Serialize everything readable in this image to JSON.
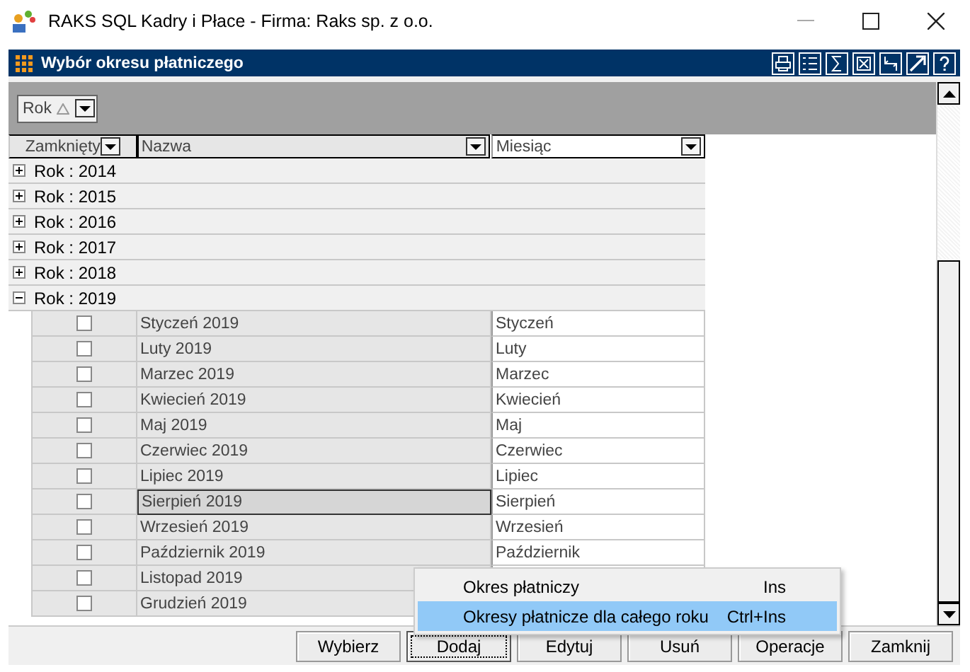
{
  "window": {
    "title": "RAKS SQL Kadry i Płace - Firma: Raks sp. z o.o."
  },
  "panel": {
    "title": "Wybór okresu płatniczego"
  },
  "group_panel": {
    "chip": "Rok"
  },
  "columns": [
    {
      "label": "Zamknięty"
    },
    {
      "label": "Nazwa"
    },
    {
      "label": "Miesiąc"
    }
  ],
  "groups": [
    {
      "label": "Rok : 2014",
      "expanded": false
    },
    {
      "label": "Rok : 2015",
      "expanded": false
    },
    {
      "label": "Rok : 2016",
      "expanded": false
    },
    {
      "label": "Rok : 2017",
      "expanded": false
    },
    {
      "label": "Rok : 2018",
      "expanded": false
    },
    {
      "label": "Rok : 2019",
      "expanded": true,
      "rows": [
        {
          "checked": false,
          "name": "Styczeń 2019",
          "month": "Styczeń",
          "selected": false
        },
        {
          "checked": false,
          "name": "Luty 2019",
          "month": "Luty",
          "selected": false
        },
        {
          "checked": false,
          "name": "Marzec 2019",
          "month": "Marzec",
          "selected": false
        },
        {
          "checked": false,
          "name": "Kwiecień 2019",
          "month": "Kwiecień",
          "selected": false
        },
        {
          "checked": false,
          "name": "Maj 2019",
          "month": "Maj",
          "selected": false
        },
        {
          "checked": false,
          "name": "Czerwiec 2019",
          "month": "Czerwiec",
          "selected": false
        },
        {
          "checked": false,
          "name": "Lipiec 2019",
          "month": "Lipiec",
          "selected": false
        },
        {
          "checked": false,
          "name": "Sierpień 2019",
          "month": "Sierpień",
          "selected": true
        },
        {
          "checked": false,
          "name": "Wrzesień 2019",
          "month": "Wrzesień",
          "selected": false
        },
        {
          "checked": false,
          "name": "Październik 2019",
          "month": "Październik",
          "selected": false
        },
        {
          "checked": false,
          "name": "Listopad 2019",
          "selected": false
        },
        {
          "checked": false,
          "name": "Grudzień 2019",
          "selected": false
        }
      ]
    }
  ],
  "buttons": [
    {
      "label": "Wybierz",
      "focused": false
    },
    {
      "label": "Dodaj",
      "focused": true
    },
    {
      "label": "Edytuj",
      "focused": false
    },
    {
      "label": "Usuń",
      "focused": false
    },
    {
      "label": "Operacje",
      "focused": false
    },
    {
      "label": "Zamknij",
      "focused": false
    }
  ],
  "menu": {
    "items": [
      {
        "label": "Okres płatniczy",
        "shortcut": "Ins",
        "selected": false
      },
      {
        "label": "Okresy płatnicze dla całego roku",
        "shortcut": "Ctrl+Ins",
        "selected": true
      }
    ]
  }
}
